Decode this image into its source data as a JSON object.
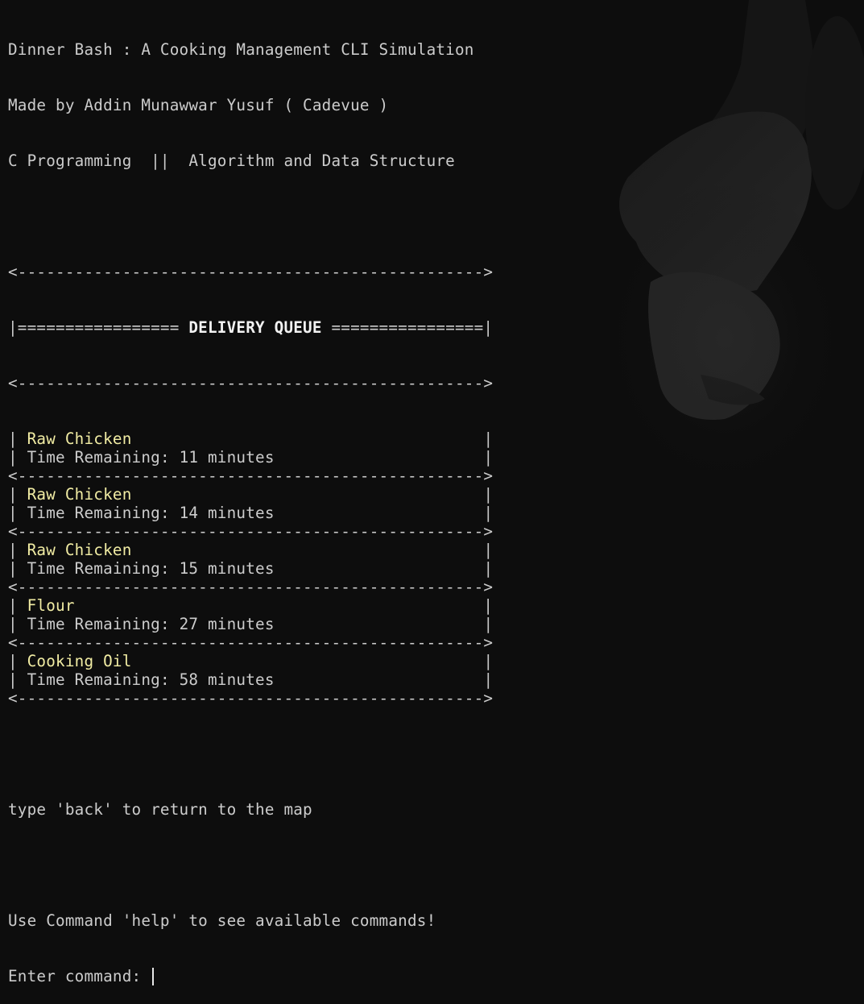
{
  "window": {
    "type": "terminal"
  },
  "header": {
    "title": "Dinner Bash : A Cooking Management CLI Simulation",
    "author": "Made by Addin Munawwar Yusuf ( Cadevue )",
    "subtitle": "C Programming  ||  Algorithm and Data Structure"
  },
  "queue": {
    "border": "<------------------------------------------------->",
    "title_left": "|================= ",
    "title": "DELIVERY QUEUE",
    "title_right": " ================|",
    "time_prefix": "Time Remaining: ",
    "time_suffix": " minutes",
    "items": [
      {
        "name": "Raw Chicken",
        "minutes": "11"
      },
      {
        "name": "Raw Chicken",
        "minutes": "14"
      },
      {
        "name": "Raw Chicken",
        "minutes": "15"
      },
      {
        "name": "Flour",
        "minutes": "27"
      },
      {
        "name": "Cooking Oil",
        "minutes": "58"
      }
    ]
  },
  "footer": {
    "back_hint": "type 'back' to return to the map",
    "help_hint": "Use Command 'help' to see available commands!",
    "prompt": "Enter command: ",
    "input_value": ""
  },
  "colors": {
    "background": "#0d0d0d",
    "text": "#cccccc",
    "item_name": "#f2eda4"
  }
}
